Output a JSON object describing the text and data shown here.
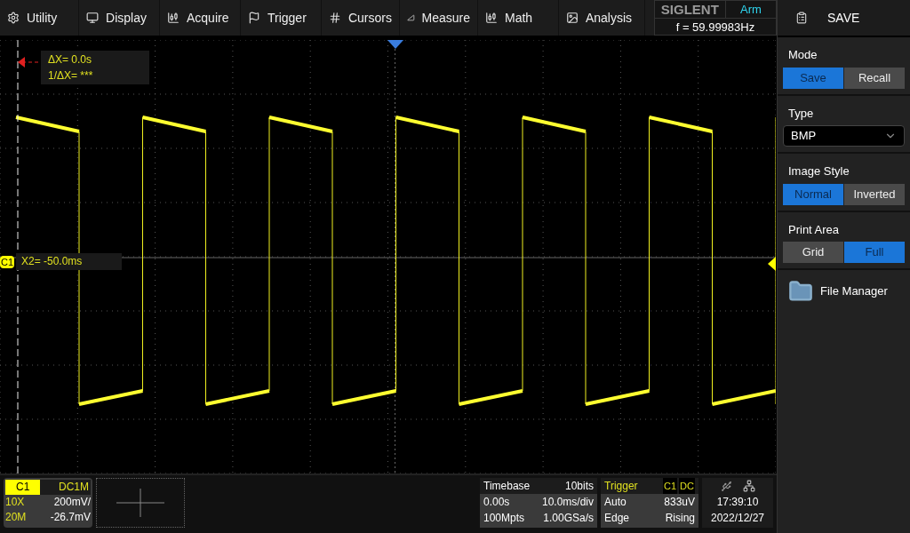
{
  "menu": [
    {
      "label": "Utility"
    },
    {
      "label": "Display"
    },
    {
      "label": "Acquire"
    },
    {
      "label": "Trigger"
    },
    {
      "label": "Cursors"
    },
    {
      "label": "Measure"
    },
    {
      "label": "Math"
    },
    {
      "label": "Analysis"
    }
  ],
  "brand": {
    "logo": "SIGLENT",
    "status": "Arm",
    "frequency": "f = 59.99983Hz"
  },
  "cursor": {
    "delta": "ΔX= 0.0s",
    "inverse": "1/ΔX= ***",
    "x2": "X2= -50.0ms",
    "channel_marker": "C1"
  },
  "panel": {
    "title": "SAVE",
    "sections": [
      {
        "label": "Mode",
        "kind": "toggle",
        "options": [
          {
            "label": "Save",
            "selected": true
          },
          {
            "label": "Recall",
            "selected": false
          }
        ]
      },
      {
        "label": "Type",
        "kind": "dropdown",
        "value": "BMP"
      },
      {
        "label": "Image Style",
        "kind": "toggle",
        "options": [
          {
            "label": "Normal",
            "selected": true
          },
          {
            "label": "Inverted",
            "selected": false
          }
        ]
      },
      {
        "label": "Print Area",
        "kind": "toggle",
        "options": [
          {
            "label": "Grid",
            "selected": false
          },
          {
            "label": "Full",
            "selected": true
          }
        ]
      }
    ],
    "file_manager": "File Manager"
  },
  "channel": {
    "name": "C1",
    "coupling": "DC1M",
    "probe": "10X",
    "scale": "200mV/",
    "bandwidth": "20M",
    "offset": "-26.7mV"
  },
  "timebase": {
    "title": "Timebase",
    "bits": "10bits",
    "delay": "0.00s",
    "scale": "10.0ms/div",
    "memory": "100Mpts",
    "rate": "1.00GSa/s"
  },
  "trigger": {
    "title": "Trigger",
    "source": "C1",
    "coupling": "DC",
    "mode": "Auto",
    "level": "833uV",
    "type": "Edge",
    "slope": "Rising"
  },
  "clock": {
    "time": "17:39:10",
    "date": "2022/12/27"
  }
}
